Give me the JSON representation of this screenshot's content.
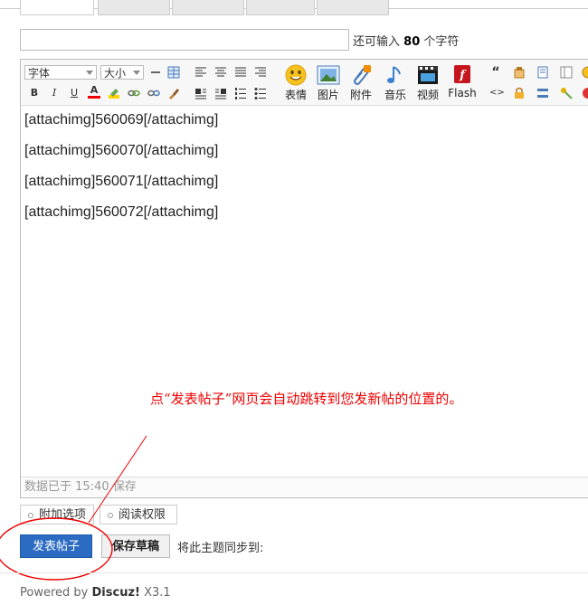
{
  "title_field": {
    "value": "",
    "remaining_prefix": "还可输入",
    "remaining_count": "80",
    "remaining_suffix": "个字符"
  },
  "toolbar": {
    "font_label": "字体",
    "size_label": "大小",
    "small_icons_row1": [
      "hr-icon",
      "table-icon",
      "align-left-icon",
      "align-center-icon",
      "align-justify-icon",
      "align-right-icon"
    ],
    "small_icons_row2": [
      "bold-icon",
      "italic-icon",
      "underline-icon",
      "font-color-icon",
      "highlight-icon",
      "link-icon",
      "unlink-icon",
      "format-brush-icon",
      "float-left-icon",
      "float-right-icon",
      "ordered-list-icon",
      "unordered-list-icon"
    ],
    "bold_glyph": "B",
    "italic_glyph": "I",
    "underline_glyph": "U",
    "color_glyph": "A",
    "big_buttons": [
      {
        "label": "表情",
        "icon": "emoji-icon"
      },
      {
        "label": "图片",
        "icon": "image-icon"
      },
      {
        "label": "附件",
        "icon": "attachment-icon"
      },
      {
        "label": "音乐",
        "icon": "music-icon"
      },
      {
        "label": "视频",
        "icon": "video-icon"
      },
      {
        "label": "Flash",
        "icon": "flash-icon"
      }
    ],
    "quote_glyph": "“",
    "code_glyph": "<>"
  },
  "editor": {
    "lines": [
      "[attachimg]560069[/attachimg]",
      "[attachimg]560070[/attachimg]",
      "[attachimg]560071[/attachimg]",
      "[attachimg]560072[/attachimg]"
    ],
    "status": "数据已于 15:40 保存"
  },
  "annotation": {
    "text": "点“发表帖子”网页会自动跳转到您发新帖的位置的。",
    "color": "#e00000"
  },
  "options": {
    "extra_options": "附加选项",
    "read_permission": "阅读权限"
  },
  "actions": {
    "submit": "发表帖子",
    "save_draft": "保存草稿",
    "sync_label": "将此主题同步到:"
  },
  "footer": {
    "powered_by": "Powered by",
    "brand": "Discuz!",
    "version": "X3.1"
  },
  "colors": {
    "submit_bg": "#2c6bc2",
    "annotation": "#e00000",
    "accent": "#2c6bc2"
  }
}
